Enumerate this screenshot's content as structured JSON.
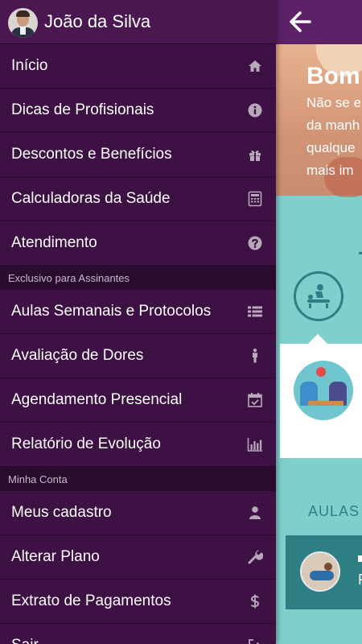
{
  "drawer": {
    "user_name": "João da Silva",
    "items": [
      {
        "label": "Início",
        "icon": "home-icon"
      },
      {
        "label": "Dicas de Profisionais",
        "icon": "info-icon"
      },
      {
        "label": "Descontos e Benefícios",
        "icon": "gift-icon"
      },
      {
        "label": "Calculadoras da Saúde",
        "icon": "calculator-icon"
      },
      {
        "label": "Atendimento",
        "icon": "question-icon"
      }
    ],
    "section_subscribers": "Exclusivo para Assinantes",
    "subscriber_items": [
      {
        "label": "Aulas Semanais e Protocolos",
        "icon": "list-icon"
      },
      {
        "label": "Avaliação de Dores",
        "icon": "person-icon"
      },
      {
        "label": "Agendamento Presencial",
        "icon": "calendar-check-icon"
      },
      {
        "label": "Relatório de Evolução",
        "icon": "bar-chart-icon"
      }
    ],
    "section_account": "Minha Conta",
    "account_items": [
      {
        "label": "Meus cadastro",
        "icon": "user-icon"
      },
      {
        "label": "Alterar Plano",
        "icon": "wrench-icon"
      },
      {
        "label": "Extrato de Pagamentos",
        "icon": "dollar-icon"
      },
      {
        "label": "Sair",
        "icon": "sign-out-icon"
      }
    ]
  },
  "main": {
    "hero_title": "Bom",
    "hero_lines": [
      "Não se e",
      "da manh",
      "qualque",
      "mais im"
    ],
    "aulas_label": "AULAS",
    "class_card_initial": "F"
  },
  "colors": {
    "drawer_bg": "#3d1143",
    "drawer_header": "#4a1750",
    "section_bg": "#2b0c31",
    "topbar": "#5d2167",
    "teal": "#7fd0cd",
    "teal_dark": "#2d7f84"
  }
}
